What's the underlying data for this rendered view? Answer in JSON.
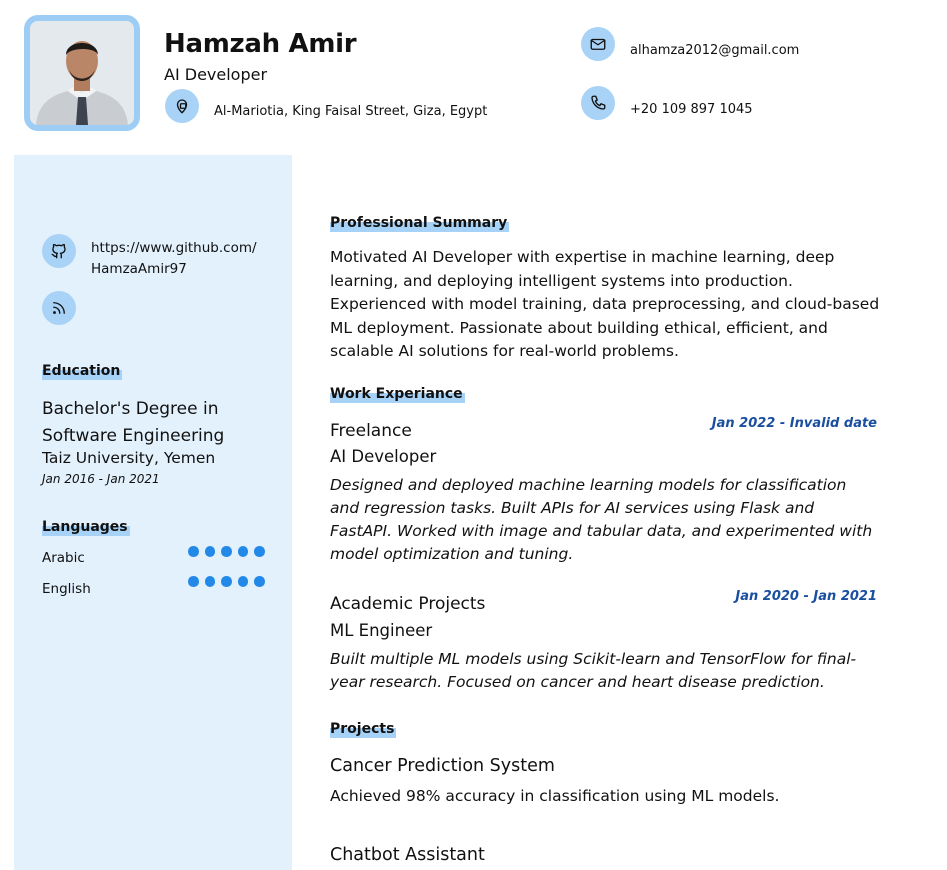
{
  "header": {
    "name": "Hamzah Amir",
    "role": "AI Developer",
    "address": "Al-Mariotia, King Faisal Street, Giza, Egypt",
    "email": "alhamza2012@gmail.com",
    "phone": "+20 109 897 1045",
    "icons": [
      "location-icon",
      "mail-icon",
      "phone-icon"
    ]
  },
  "sidebar": {
    "links": [
      {
        "icon": "github-icon",
        "text": "https://www.github.com/HamzaAmir97"
      },
      {
        "icon": "rss-icon",
        "text": ""
      }
    ],
    "education": {
      "title": "Education",
      "degree": "Bachelor's Degree in Software Engineering",
      "school": "Taiz University, Yemen",
      "dates": "Jan 2016 - Jan 2021"
    },
    "languages": {
      "title": "Languages",
      "items": [
        {
          "name": "Arabic",
          "level": 5,
          "max": 5
        },
        {
          "name": "English",
          "level": 5,
          "max": 5
        }
      ]
    }
  },
  "main": {
    "summary": {
      "title": "Professional Summary",
      "text": "Motivated AI Developer with expertise in machine learning, deep learning, and deploying intelligent systems into production. Experienced with model training, data preprocessing, and cloud-based ML deployment. Passionate about building ethical, efficient, and scalable AI solutions for real-world problems."
    },
    "work": {
      "title": "Work Experiance",
      "jobs": [
        {
          "company": "Freelance",
          "role": "AI Developer",
          "dates": "Jan 2022 - Invalid date",
          "description": "Designed and deployed machine learning models for classification and regression tasks. Built APIs for AI services using Flask and FastAPI. Worked with image and tabular data, and experimented with model optimization and tuning."
        },
        {
          "company": "Academic Projects",
          "role": "ML Engineer",
          "dates": "Jan 2020 - Jan 2021",
          "description": "Built multiple ML models using Scikit-learn and TensorFlow for final-year research. Focused on cancer and heart disease prediction."
        }
      ]
    },
    "projects": {
      "title": "Projects",
      "items": [
        {
          "name": "Cancer Prediction System",
          "description": "Achieved 98% accuracy in classification using ML models."
        },
        {
          "name": "Chatbot Assistant",
          "description": ""
        }
      ]
    }
  },
  "colors": {
    "accent": "#a6d2f7",
    "sidebar_bg": "#e3f1fd",
    "dot": "#2389e8",
    "date": "#1a4fa0"
  }
}
